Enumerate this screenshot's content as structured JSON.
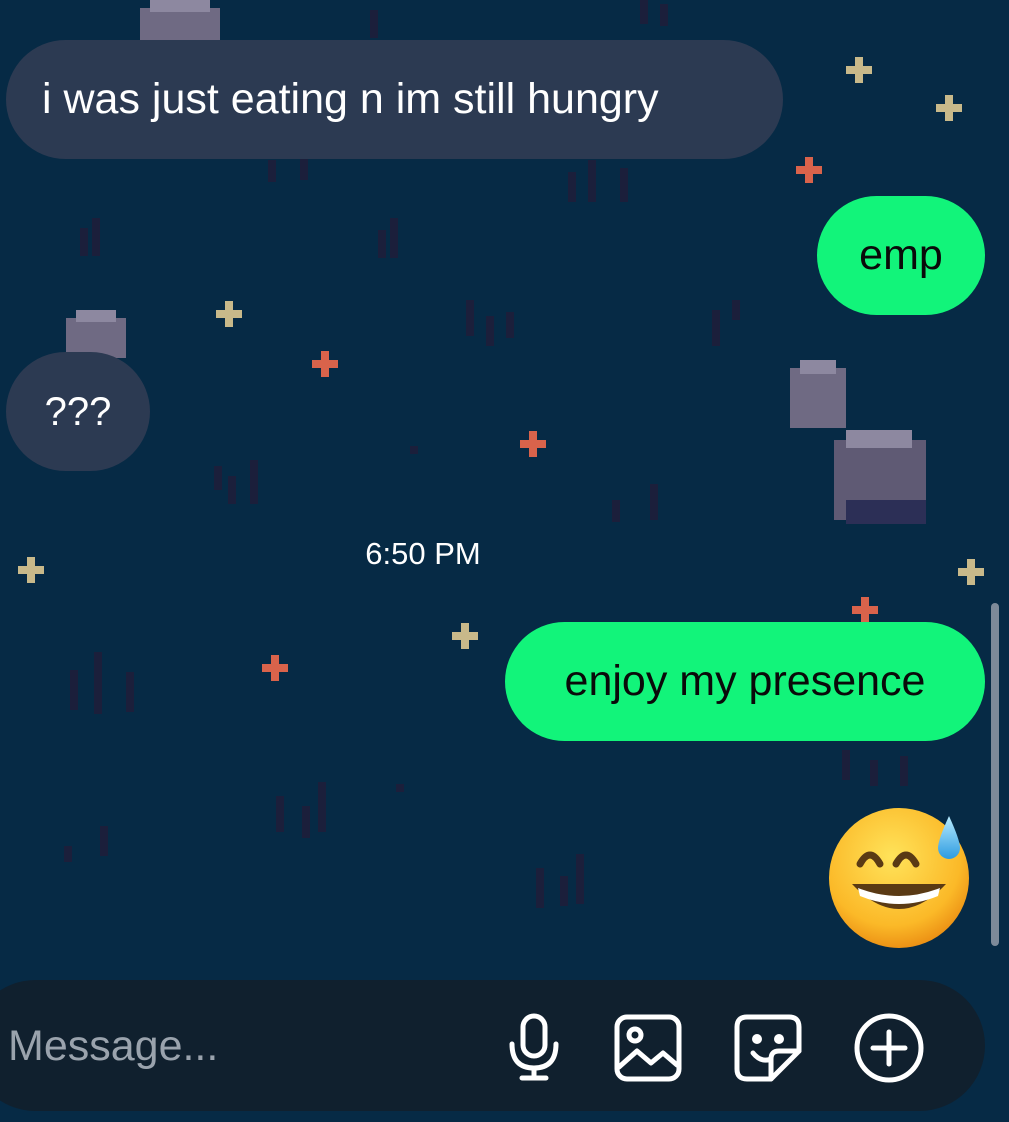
{
  "messages": [
    {
      "id": "msg1",
      "direction": "incoming",
      "text": "i was just eating n im still hungry"
    },
    {
      "id": "msg2",
      "direction": "outgoing",
      "text": "emp"
    },
    {
      "id": "msg3",
      "direction": "incoming",
      "text": "???"
    },
    {
      "id": "msg4",
      "direction": "outgoing",
      "text": "enjoy my presence"
    },
    {
      "id": "msg5",
      "direction": "outgoing",
      "emoji": "grinning-face-with-sweat"
    }
  ],
  "timestamp": "6:50 PM",
  "composer": {
    "placeholder": "Message...",
    "icons": [
      "microphone-icon",
      "gallery-icon",
      "sticker-icon",
      "plus-circle-icon"
    ]
  },
  "colors": {
    "background": "#062a45",
    "incoming_bubble": "#2c3a52",
    "outgoing_bubble": "#12f47a",
    "composer": "#10202e"
  }
}
